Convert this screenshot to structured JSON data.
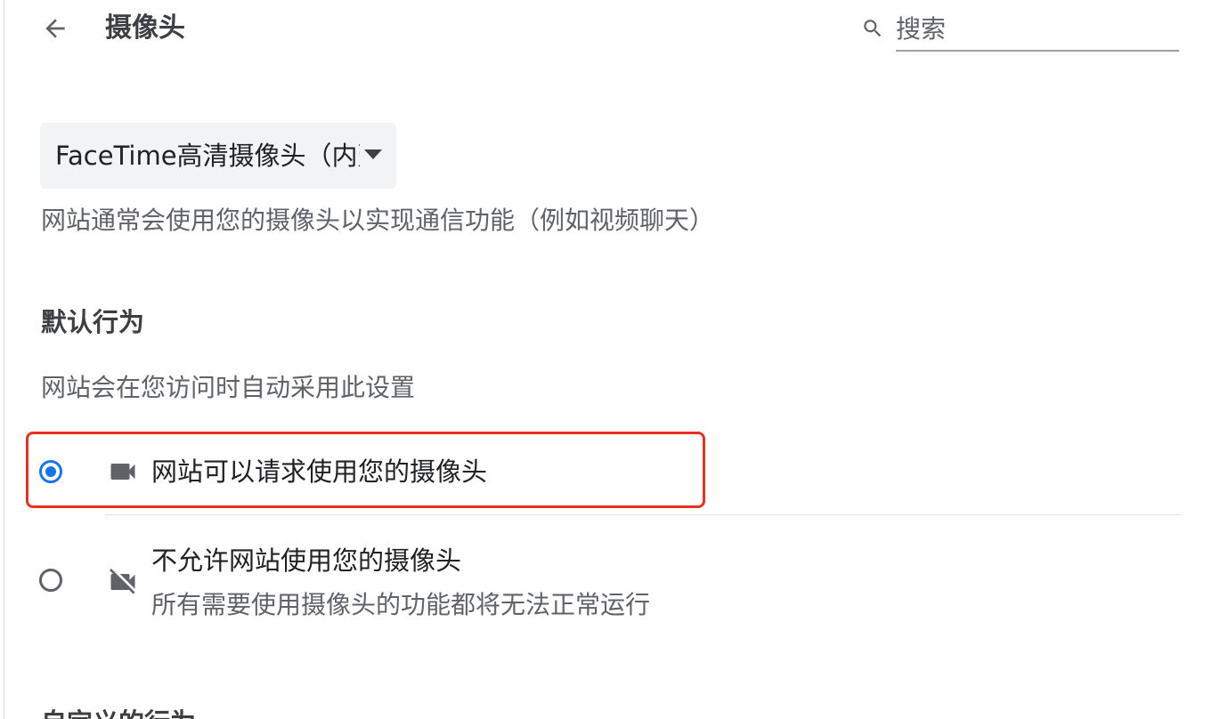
{
  "header": {
    "title": "摄像头",
    "search_placeholder": "搜索"
  },
  "camera_select": {
    "selected_value": "FaceTime高清摄像头（内建）"
  },
  "description": "网站通常会使用您的摄像头以实现通信功能（例如视频聊天）",
  "default_behavior": {
    "heading": "默认行为",
    "subtitle": "网站会在您访问时自动采用此设置",
    "options": [
      {
        "label": "网站可以请求使用您的摄像头",
        "selected": true,
        "icon": "videocam-icon"
      },
      {
        "label": "不允许网站使用您的摄像头",
        "sublabel": "所有需要使用摄像头的功能都将无法正常运行",
        "selected": false,
        "icon": "videocam-off-icon"
      }
    ]
  },
  "custom_behavior": {
    "heading": "自定义的行为"
  },
  "colors": {
    "accent": "#1a73e8",
    "highlight_border": "#e8321f",
    "select_bg": "#f1f3f4",
    "secondary_text": "#5f6368"
  }
}
